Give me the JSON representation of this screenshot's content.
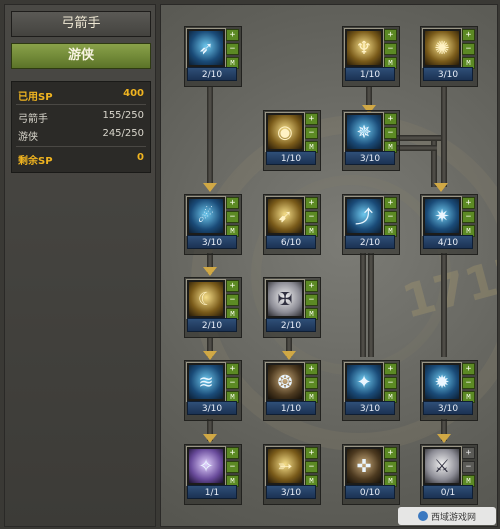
{
  "left_panel": {
    "title": "弓箭手",
    "subclass": "游侠",
    "sp": {
      "used_label": "已用SP",
      "used_value": "400",
      "rows": [
        {
          "label": "弓箭手",
          "value": "155/250"
        },
        {
          "label": "游侠",
          "value": "245/250"
        }
      ],
      "remaining_label": "剩余SP",
      "remaining_value": "0"
    }
  },
  "skills": [
    {
      "id": "s1",
      "level": "2/10",
      "icon": "wind-arrow-icon",
      "glyph": "➶",
      "tone": "blue"
    },
    {
      "id": "s2",
      "level": "1/10",
      "icon": "golden-figure-icon",
      "glyph": "♆",
      "tone": "gold"
    },
    {
      "id": "s3",
      "level": "3/10",
      "icon": "gold-spiral-icon",
      "glyph": "✺",
      "tone": "gold"
    },
    {
      "id": "s4",
      "level": "1/10",
      "icon": "ring-icon",
      "glyph": "◉",
      "tone": "gold"
    },
    {
      "id": "s5",
      "level": "3/10",
      "icon": "blue-burst-icon",
      "glyph": "✵",
      "tone": "blue"
    },
    {
      "id": "s6",
      "level": "3/10",
      "icon": "kick-icon",
      "glyph": "☄",
      "tone": "blue"
    },
    {
      "id": "s7",
      "level": "6/10",
      "icon": "dash-icon",
      "glyph": "➹",
      "tone": "gold"
    },
    {
      "id": "s8",
      "level": "2/10",
      "icon": "leap-icon",
      "glyph": "⤴",
      "tone": "blue"
    },
    {
      "id": "s9",
      "level": "4/10",
      "icon": "spin-kick-icon",
      "glyph": "✷",
      "tone": "blue"
    },
    {
      "id": "s10",
      "level": "2/10",
      "icon": "crescent-icon",
      "glyph": "☾",
      "tone": "gold"
    },
    {
      "id": "s11",
      "level": "2/10",
      "icon": "shield-cross-icon",
      "glyph": "✠",
      "tone": "silver"
    },
    {
      "id": "s12",
      "level": "3/10",
      "icon": "wind-slash-icon",
      "glyph": "≋",
      "tone": "blue"
    },
    {
      "id": "s13",
      "level": "1/10",
      "icon": "orange-ring-icon",
      "glyph": "❂",
      "tone": "dark"
    },
    {
      "id": "s14",
      "level": "3/10",
      "icon": "ice-arrow-icon",
      "glyph": "✦",
      "tone": "blue"
    },
    {
      "id": "s15",
      "level": "3/10",
      "icon": "blue-dash-icon",
      "glyph": "✹",
      "tone": "blue"
    },
    {
      "id": "s16",
      "level": "1/1",
      "icon": "purple-orb-icon",
      "glyph": "✧",
      "tone": "purple"
    },
    {
      "id": "s17",
      "level": "3/10",
      "icon": "golden-arrow-icon",
      "glyph": "➳",
      "tone": "gold"
    },
    {
      "id": "s18",
      "level": "0/10",
      "icon": "compass-icon",
      "glyph": "✜",
      "tone": "dark"
    },
    {
      "id": "s19",
      "level": "0/1",
      "icon": "silver-stance-icon",
      "glyph": "⚔",
      "tone": "silver",
      "disabled": true
    }
  ],
  "button_labels": {
    "plus": "+",
    "minus": "−",
    "master": "M"
  },
  "watermark": "17173",
  "site_logo": "西域游戏网"
}
